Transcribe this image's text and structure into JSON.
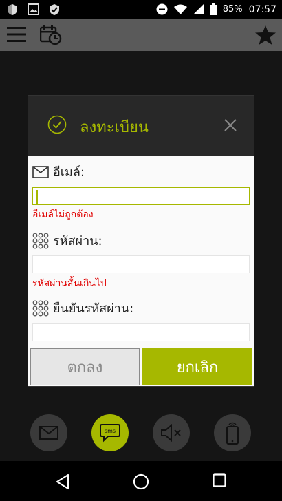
{
  "status_bar": {
    "battery_text": "85%",
    "time": "07:57",
    "left_icons": [
      "shield-icon",
      "image-icon",
      "shield-check-icon"
    ],
    "right_icons": [
      "do-not-disturb-icon",
      "wifi-icon",
      "signal-icon",
      "battery-icon"
    ]
  },
  "app_bar": {
    "icons": [
      "menu-icon",
      "calendar-clock-icon",
      "star-icon"
    ]
  },
  "dialog": {
    "title": "ลงทะเบียน",
    "email": {
      "label": "อีเมล์:",
      "value": "",
      "error": "อีเมล์ไม่ถูกต้อง"
    },
    "password": {
      "label": "รหัสผ่าน:",
      "value": "",
      "error": "รหัสผ่านสั้นเกินไป"
    },
    "confirm_password": {
      "label": "ยืนยันรหัสผ่าน:",
      "value": ""
    },
    "ok_label": "ตกลง",
    "cancel_label": "ยกเลิก"
  },
  "bottom_actions": {
    "items": [
      "email-icon",
      "sms-icon",
      "mute-icon",
      "phone-ring-icon"
    ],
    "sms_text": "sms"
  },
  "colors": {
    "accent": "#a6b800",
    "error": "#e00000",
    "dialog_header": "#282828",
    "appbar": "#5a5a5a"
  },
  "nav_bar": {
    "icons": [
      "back-icon",
      "home-icon",
      "recents-icon"
    ]
  }
}
